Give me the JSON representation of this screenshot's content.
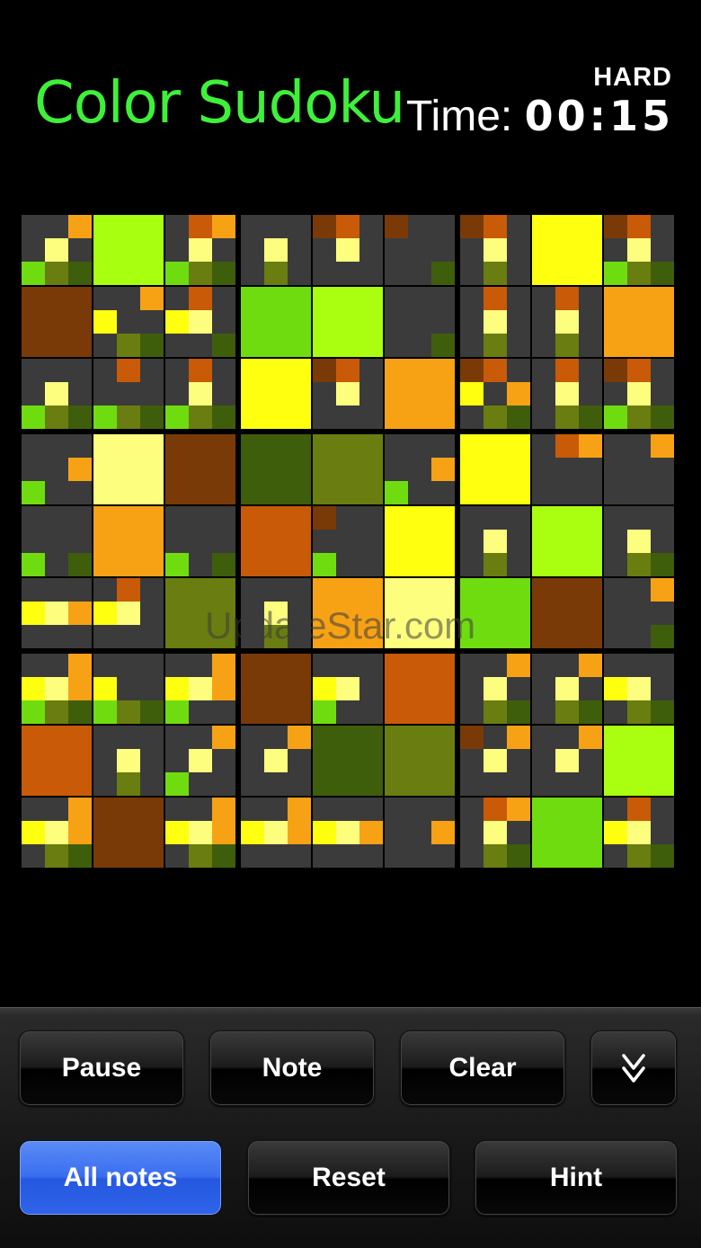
{
  "header": {
    "title": "Color Sudoku",
    "difficulty": "HARD",
    "time_label": "Time:",
    "time_value": "00:15"
  },
  "watermark": "UpdateStar.com",
  "colors": {
    "1": "#7a3a08",
    "2": "#c85a08",
    "3": "#f59a10",
    "4": "#f7a215",
    "5": "#ffff10",
    "6": "#fefe7e",
    "7": "#aaff10",
    "8": "#6fdc10",
    "9": "#6a7d10",
    "10": "#3e5e0c"
  },
  "note_palette": [
    "#7a3a08",
    "#c85a08",
    "#f7a215",
    "#fefe7e",
    "#fff",
    "#fff",
    "#6fdc10",
    "#6a7d10",
    "#3e5e0c"
  ],
  "board": {
    "fills": [
      [
        0,
        "#a8ff10",
        0,
        0,
        0,
        0,
        0,
        "#ffff10",
        0
      ],
      [
        "#7a3a08",
        0,
        0,
        "#6fdc10",
        "#aaff10",
        0,
        0,
        0,
        "#f7a215"
      ],
      [
        0,
        0,
        0,
        "#ffff10",
        0,
        "#f7a215",
        0,
        0,
        0
      ],
      [
        0,
        "#fefe7e",
        "#7a3a08",
        "#3e5e0c",
        "#6a7d10",
        0,
        "#ffff10",
        0,
        0
      ],
      [
        0,
        "#f7a215",
        0,
        "#c85a08",
        0,
        "#ffff10",
        0,
        "#aaff10",
        0
      ],
      [
        0,
        0,
        "#6a7d10",
        0,
        "#f7a215",
        "#fefe7e",
        "#6fdc10",
        "#7a3a08",
        0
      ],
      [
        0,
        0,
        0,
        "#7a3a08",
        0,
        "#c85a08",
        0,
        0,
        0
      ],
      [
        "#c85a08",
        0,
        0,
        0,
        "#3e5e0c",
        "#6a7d10",
        0,
        0,
        "#aaff10"
      ],
      [
        0,
        "#7a3a08",
        0,
        0,
        0,
        0,
        0,
        "#6fdc10",
        0
      ]
    ],
    "notes": [
      [
        [
          2,
          4,
          6,
          7,
          8
        ],
        [],
        [
          1,
          2,
          4,
          6,
          7,
          8
        ],
        [
          4,
          7
        ],
        [
          0,
          1,
          4
        ],
        [
          0,
          8
        ],
        [
          0,
          1,
          4,
          7
        ],
        [],
        [
          0,
          1,
          4,
          6,
          7,
          8
        ]
      ],
      [
        [],
        [
          2,
          3,
          7,
          8
        ],
        [
          1,
          3,
          4,
          8
        ],
        [],
        [],
        [
          8
        ],
        [
          1,
          4,
          7
        ],
        [
          1,
          4,
          7
        ],
        []
      ],
      [
        [
          4,
          6,
          7,
          8
        ],
        [
          1,
          6,
          7,
          8
        ],
        [
          1,
          4,
          6,
          7,
          8
        ],
        [],
        [
          0,
          1,
          4
        ],
        [],
        [
          0,
          1,
          3,
          5,
          7,
          8
        ],
        [
          1,
          4,
          7,
          8
        ],
        [
          0,
          1,
          4,
          6,
          7,
          8
        ]
      ],
      [
        [
          5,
          6
        ],
        [],
        [],
        [],
        [],
        [
          5,
          6
        ],
        [],
        [
          1,
          2
        ],
        [
          2
        ]
      ],
      [
        [
          6,
          8
        ],
        [],
        [
          6,
          8
        ],
        [],
        [
          0,
          6
        ],
        [],
        [
          4,
          7
        ],
        [],
        [
          4,
          7,
          8
        ]
      ],
      [
        [
          3,
          4,
          5
        ],
        [
          1,
          3,
          4
        ],
        [],
        [
          4,
          7
        ],
        [],
        [],
        [],
        [],
        [
          2,
          8
        ]
      ],
      [
        [
          2,
          3,
          4,
          5,
          6,
          7,
          8
        ],
        [
          3,
          6,
          7,
          8
        ],
        [
          2,
          3,
          4,
          5,
          6
        ],
        [],
        [
          3,
          4,
          6
        ],
        [],
        [
          2,
          4,
          7,
          8
        ],
        [
          2,
          4,
          7,
          8
        ],
        [
          3,
          4,
          7,
          8
        ]
      ],
      [
        [],
        [
          4,
          7
        ],
        [
          2,
          4,
          6
        ],
        [
          2,
          4
        ],
        [],
        [],
        [
          0,
          2,
          4
        ],
        [
          2,
          4
        ],
        []
      ],
      [
        [
          2,
          3,
          4,
          5,
          7,
          8
        ],
        [],
        [
          2,
          3,
          4,
          5,
          7,
          8
        ],
        [
          2,
          3,
          4,
          5
        ],
        [
          3,
          4,
          5
        ],
        [
          5
        ],
        [
          1,
          2,
          4,
          7,
          8
        ],
        [],
        [
          1,
          3,
          4,
          7,
          8
        ]
      ]
    ]
  },
  "buttons": {
    "pause": "Pause",
    "note": "Note",
    "clear": "Clear",
    "all_notes": "All notes",
    "reset": "Reset",
    "hint": "Hint"
  }
}
